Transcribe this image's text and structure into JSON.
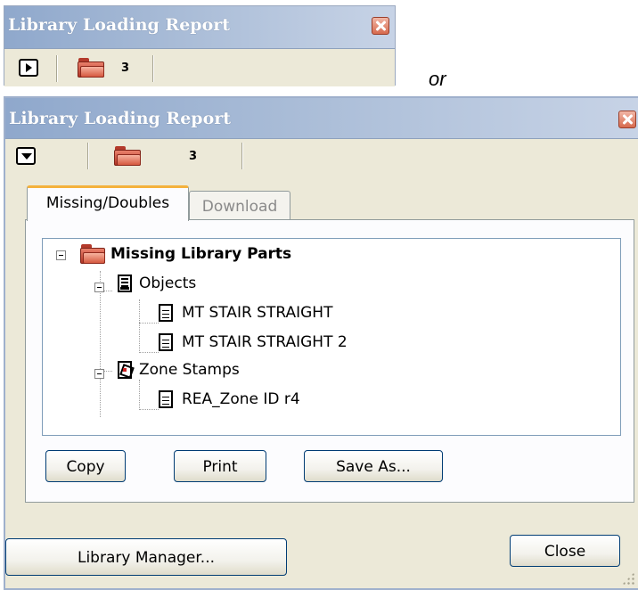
{
  "small_palette": {
    "title": "Library Loading Report",
    "missing_count": "3",
    "close_icon": "close-x-icon",
    "expand_icon": "triangle-right-icon"
  },
  "separator_text": "or",
  "main_palette": {
    "title": "Library Loading Report",
    "missing_count": "3",
    "close_icon": "close-x-icon",
    "collapse_icon": "triangle-down-icon",
    "tabs": [
      {
        "label": "Missing/Doubles",
        "active": true
      },
      {
        "label": "Download",
        "active": false
      }
    ],
    "tree": {
      "root": "Missing Library Parts",
      "groups": [
        {
          "label": "Objects",
          "items": [
            "MT STAIR STRAIGHT",
            "MT STAIR STRAIGHT 2"
          ]
        },
        {
          "label": "Zone Stamps",
          "items": [
            "REA_Zone ID r4"
          ]
        }
      ]
    },
    "buttons": {
      "copy": "Copy",
      "print": "Print",
      "save_as": "Save As...",
      "library_manager": "Library Manager...",
      "close": "Close"
    },
    "colors": {
      "title_gradient_start": "#8fa8cc",
      "dialog_bg": "#ece9d8",
      "active_tab_accent": "#f4b13c",
      "folder_red": "#c5432f"
    }
  }
}
